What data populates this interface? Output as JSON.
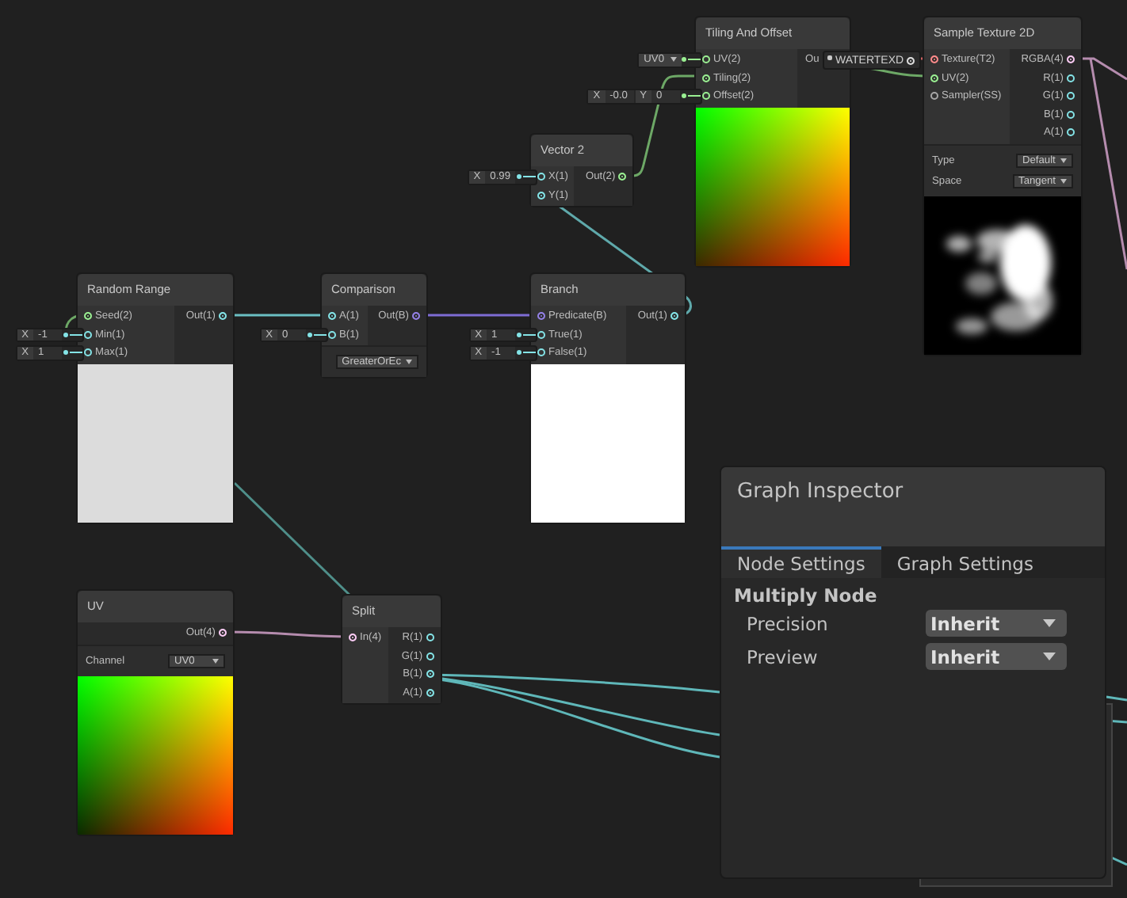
{
  "property_node": {
    "label": "WATERTEXD"
  },
  "nodes": [
    {
      "title": "Tiling And Offset",
      "inputs": [
        {
          "label": "UV(2)",
          "color": "#9aef92",
          "connected": false,
          "control": {
            "kind": "dropdown",
            "value": "UV0"
          }
        },
        {
          "label": "Tiling(2)",
          "color": "#9aef92",
          "connected": true
        },
        {
          "label": "Offset(2)",
          "color": "#9aef92",
          "connected": false,
          "control": {
            "kind": "vector",
            "fields": [
              {
                "axis": "X",
                "value": "-0.0"
              },
              {
                "axis": "Y",
                "value": "0"
              }
            ]
          }
        }
      ],
      "outputs": [
        {
          "label": "Ou"
        }
      ],
      "preview": {
        "kind": "uv-gradient"
      }
    },
    {
      "title": "Sample Texture 2D",
      "inputs": [
        {
          "label": "Texture(T2)",
          "color": "#ff8b8b",
          "connected": true
        },
        {
          "label": "UV(2)",
          "color": "#9aef92",
          "connected": true
        },
        {
          "label": "Sampler(SS)",
          "color": "#a8a8a8",
          "connected": false
        }
      ],
      "outputs": [
        {
          "label": "RGBA(4)",
          "color": "#fbcbf4",
          "connected": true
        },
        {
          "label": "R(1)",
          "color": "#84e4e7",
          "connected": false
        },
        {
          "label": "G(1)",
          "color": "#84e4e7",
          "connected": false
        },
        {
          "label": "B(1)",
          "color": "#84e4e7",
          "connected": false
        },
        {
          "label": "A(1)",
          "color": "#84e4e7",
          "connected": false
        }
      ],
      "settings": [
        {
          "label": "Type",
          "value": "Default"
        },
        {
          "label": "Space",
          "value": "Tangent"
        }
      ],
      "preview": {
        "kind": "picture"
      }
    },
    {
      "title": "Vector 2",
      "inputs": [
        {
          "label": "X(1)",
          "color": "#84e4e7",
          "connected": false,
          "control": {
            "kind": "vector",
            "fields": [
              {
                "axis": "X",
                "value": "0.99"
              }
            ]
          }
        },
        {
          "label": "Y(1)",
          "color": "#84e4e7",
          "connected": true
        }
      ],
      "outputs": [
        {
          "label": "Out(2)",
          "color": "#9aef92",
          "connected": true
        }
      ]
    },
    {
      "title": "Random Range",
      "inputs": [
        {
          "label": "Seed(2)",
          "color": "#9aef92",
          "connected": true
        },
        {
          "label": "Min(1)",
          "color": "#84e4e7",
          "connected": false,
          "control": {
            "kind": "vector",
            "fields": [
              {
                "axis": "X",
                "value": "-1"
              }
            ]
          }
        },
        {
          "label": "Max(1)",
          "color": "#84e4e7",
          "connected": false,
          "control": {
            "kind": "vector",
            "fields": [
              {
                "axis": "X",
                "value": "1"
              }
            ]
          }
        }
      ],
      "outputs": [
        {
          "label": "Out(1)",
          "color": "#84e4e7",
          "connected": true
        }
      ],
      "preview": {
        "kind": "solid",
        "color": "#dcdcdc"
      }
    },
    {
      "title": "Comparison",
      "inputs": [
        {
          "label": "A(1)",
          "color": "#84e4e7",
          "connected": true
        },
        {
          "label": "B(1)",
          "color": "#84e4e7",
          "connected": false,
          "control": {
            "kind": "vector",
            "fields": [
              {
                "axis": "X",
                "value": "0"
              }
            ]
          }
        }
      ],
      "outputs": [
        {
          "label": "Out(B)",
          "color": "#9481e6",
          "connected": true
        }
      ],
      "settings": [
        {
          "value": "GreaterOrEc"
        }
      ]
    },
    {
      "title": "Branch",
      "inputs": [
        {
          "label": "Predicate(B)",
          "color": "#9481e6",
          "connected": true
        },
        {
          "label": "True(1)",
          "color": "#84e4e7",
          "connected": false,
          "control": {
            "kind": "vector",
            "fields": [
              {
                "axis": "X",
                "value": "1"
              }
            ]
          }
        },
        {
          "label": "False(1)",
          "color": "#84e4e7",
          "connected": false,
          "control": {
            "kind": "vector",
            "fields": [
              {
                "axis": "X",
                "value": "-1"
              }
            ]
          }
        }
      ],
      "outputs": [
        {
          "label": "Out(1)",
          "color": "#84e4e7",
          "connected": true
        }
      ],
      "preview": {
        "kind": "solid",
        "color": "#ffffff"
      }
    },
    {
      "title": "UV",
      "outputs": [
        {
          "label": "Out(4)",
          "color": "#fbcbf4",
          "connected": true
        }
      ],
      "settings": [
        {
          "label": "Channel",
          "value": "UV0"
        }
      ],
      "preview": {
        "kind": "uv-gradient"
      }
    },
    {
      "title": "Split",
      "inputs": [
        {
          "label": "In(4)",
          "color": "#fbcbf4",
          "connected": true
        }
      ],
      "outputs": [
        {
          "label": "R(1)",
          "color": "#84e4e7",
          "connected": false
        },
        {
          "label": "G(1)",
          "color": "#84e4e7",
          "connected": false
        },
        {
          "label": "B(1)",
          "color": "#84e4e7",
          "connected": true
        },
        {
          "label": "A(1)",
          "color": "#84e4e7",
          "connected": true
        }
      ]
    }
  ],
  "inspector": {
    "title": "Graph Inspector",
    "tabs": [
      {
        "label": "Node Settings",
        "selected": true
      },
      {
        "label": "Graph Settings",
        "selected": false
      }
    ],
    "section": "Multiply Node",
    "fields": [
      {
        "label": "Precision",
        "value": "Inherit"
      },
      {
        "label": "Preview",
        "value": "Inherit"
      }
    ]
  }
}
